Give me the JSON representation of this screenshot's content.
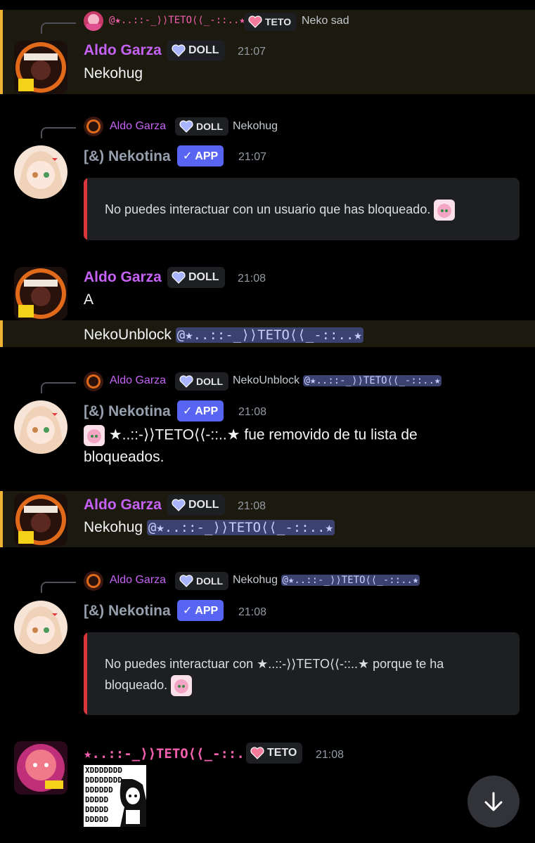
{
  "colors": {
    "aldo": "#c562f5",
    "nekotina": "#959fad",
    "teto": "#f35fae",
    "mention_bg": "#3c4270",
    "app_badge": "#5865f2",
    "highlight_bar": "#f0b232",
    "embed_bar": "#da373c"
  },
  "icons": {
    "doll_tag": "blue-heart-icon",
    "teto_tag": "pink-heart-icon",
    "app_check": "checkmark-icon",
    "scroll": "arrow-down-icon"
  },
  "messages": [
    {
      "reply": {
        "author": "@★..::-_⟩⟩TETO⟨⟨_-::..★",
        "tag": "TETO",
        "text": "Neko sad"
      },
      "author": "Aldo Garza",
      "tag": "DOLL",
      "time": "21:07",
      "lines": [
        "Nekohug"
      ]
    },
    {
      "reply": {
        "author": "Aldo Garza",
        "tag": "DOLL",
        "text": "Nekohug"
      },
      "author": "[&) Nekotina",
      "badge": "✓ APP",
      "time": "21:07",
      "embed": "No puedes interactuar con un usuario que has bloqueado."
    },
    {
      "author": "Aldo Garza",
      "tag": "DOLL",
      "time": "21:08",
      "lines": [
        "A"
      ],
      "followup": {
        "text": "NekoUnblock ",
        "mention": "@★..::-_⟩⟩TETO⟨⟨_-::..★"
      }
    },
    {
      "reply": {
        "author": "Aldo Garza",
        "tag": "DOLL",
        "text": "NekoUnblock ",
        "mention": "@★..::-_⟩⟩TETO⟨⟨_-::..★"
      },
      "author": "[&) Nekotina",
      "badge": "✓ APP",
      "time": "21:08",
      "text_a": "★..::-⟩⟩TETO⟨⟨-::..★ fue removido de tu lista de",
      "text_b": "bloqueados."
    },
    {
      "author": "Aldo Garza",
      "tag": "DOLL",
      "time": "21:08",
      "text": "Nekohug ",
      "mention": "@★..::-_⟩⟩TETO⟨⟨_-::..★"
    },
    {
      "reply": {
        "author": "Aldo Garza",
        "tag": "DOLL",
        "text": "Nekohug ",
        "mention": "@★..::-_⟩⟩TETO⟨⟨_-::..★"
      },
      "author": "[&) Nekotina",
      "badge": "✓ APP",
      "time": "21:08",
      "embed_a": "No puedes interactuar con ★..::-⟩⟩TETO⟨⟨-::..★ porque te ha",
      "embed_b": "bloqueado."
    },
    {
      "author": "★..::-_⟩⟩TETO⟨⟨_-::..★",
      "tag": "TETO",
      "time": "21:08",
      "sticker_lines": [
        "XDDDDDDD",
        "DDDDDDDD",
        "DDDDDD",
        "DDDDD",
        "DDDDD",
        "DDDDD"
      ]
    }
  ]
}
